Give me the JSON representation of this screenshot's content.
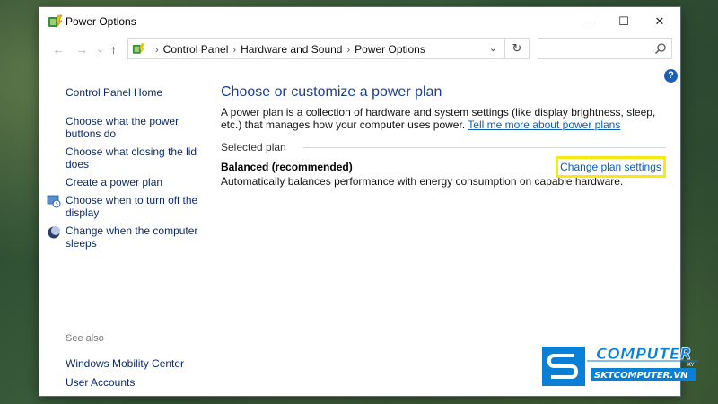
{
  "window": {
    "title": "Power Options",
    "controls": {
      "minimize": "—",
      "maximize": "☐",
      "close": "✕"
    }
  },
  "navbar": {
    "back": "←",
    "forward": "→",
    "recent": "⌄",
    "up": "↑",
    "breadcrumbs": [
      "Control Panel",
      "Hardware and Sound",
      "Power Options"
    ],
    "breadcrumb_separator": "›",
    "dropdown": "⌄",
    "refresh": "↻",
    "search_placeholder": ""
  },
  "help": {
    "label": "?"
  },
  "sidebar": {
    "home": "Control Panel Home",
    "links": [
      "Choose what the power buttons do",
      "Choose what closing the lid does",
      "Create a power plan",
      "Choose when to turn off the display",
      "Change when the computer sleeps"
    ],
    "see_also_label": "See also",
    "see_also": [
      "Windows Mobility Center",
      "User Accounts"
    ]
  },
  "main": {
    "heading": "Choose or customize a power plan",
    "description": "A power plan is a collection of hardware and system settings (like display brightness, sleep, etc.) that manages how your computer uses power.",
    "learn_more": "Tell me more about power plans",
    "selected_plan_label": "Selected plan",
    "plan_name": "Balanced (recommended)",
    "plan_description": "Automatically balances performance with energy consumption on capable hardware.",
    "change_settings": "Change plan settings"
  },
  "watermark": {
    "brand": "COMPUTER",
    "suffix": "KY",
    "site": "SKTCOMPUTER.VN"
  },
  "colors": {
    "link": "#0a5ebc",
    "heading": "#1e3e8c",
    "sidebar_link": "#0b2a6e",
    "highlight": "#f5ea14",
    "logo_blue": "#0a7fd6"
  },
  "icons": {
    "app": "power-options-icon",
    "display": "display-clock-icon",
    "sleep": "moon-sleep-icon",
    "search": "search-icon",
    "help": "help-icon"
  }
}
